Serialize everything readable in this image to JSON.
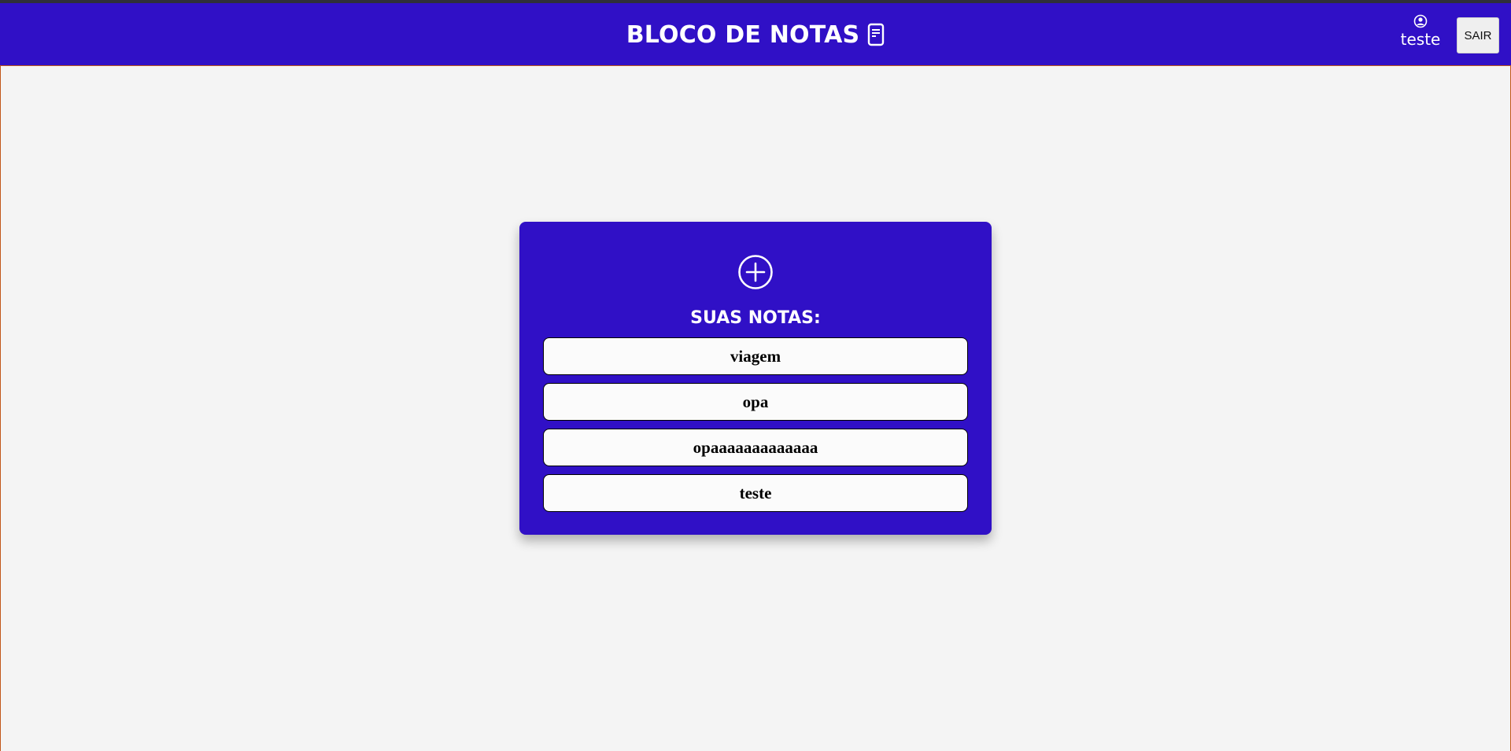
{
  "header": {
    "title": "BLOCO DE NOTAS",
    "title_icon": "document-icon",
    "user": {
      "icon": "user-circle-icon",
      "name": "teste"
    },
    "logout_label": "SAIR"
  },
  "notes_panel": {
    "add_icon": "plus-circle-icon",
    "title": "SUAS NOTAS:",
    "items": [
      {
        "label": "viagem"
      },
      {
        "label": "opa"
      },
      {
        "label": "opaaaaaaaaaaaaa"
      },
      {
        "label": "teste"
      }
    ]
  },
  "colors": {
    "brand": "#3010c6",
    "background": "#f4f4f4",
    "note_bg": "#fbfbfb"
  }
}
